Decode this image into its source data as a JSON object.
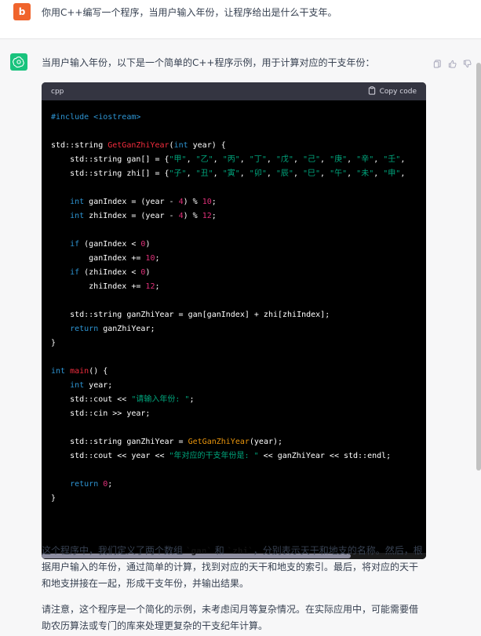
{
  "colors": {
    "user_avatar_bg": "#f0642c",
    "assistant_avatar_bg": "#19c37d"
  },
  "user": {
    "avatar_letter": "b",
    "message": "你用C++编写一个程序，当用户输入年份，让程序给出是什么干支年。"
  },
  "assistant": {
    "intro": "当用户输入年份，以下是一个简单的C++程序示例，用于计算对应的干支年份：",
    "code_language": "cpp",
    "copy_label": "Copy code",
    "paragraph1_before": "这个程序中，我们定义了两个数组 ",
    "paragraph1_code1": "`gan`",
    "paragraph1_mid": " 和 ",
    "paragraph1_code2": "`zhi`",
    "paragraph1_after": "，分别表示天干和地支的名称。然后，根据用户输入的年份，通过简单的计算，找到对应的天干和地支的索引。最后，将对应的天干和地支拼接在一起，形成干支年份，并输出结果。",
    "paragraph2": "请注意，这个程序是一个简化的示例，未考虑闰月等复杂情况。在实际应用中，可能需要借助农历算法或专门的库来处理更复杂的干支纪年计算。"
  },
  "code_lines": [
    "#include <iostream>",
    "",
    "std::string GetGanZhiYear(int year) {",
    "    std::string gan[] = {\"甲\", \"乙\", \"丙\", \"丁\", \"戊\", \"己\", \"庚\", \"辛\", \"壬\",",
    "    std::string zhi[] = {\"子\", \"丑\", \"寅\", \"卯\", \"辰\", \"巳\", \"午\", \"未\", \"申\",",
    "",
    "    int ganIndex = (year - 4) % 10;",
    "    int zhiIndex = (year - 4) % 12;",
    "",
    "    if (ganIndex < 0)",
    "        ganIndex += 10;",
    "    if (zhiIndex < 0)",
    "        zhiIndex += 12;",
    "",
    "    std::string ganZhiYear = gan[ganIndex] + zhi[zhiIndex];",
    "    return ganZhiYear;",
    "}",
    "",
    "int main() {",
    "    int year;",
    "    std::cout << \"请输入年份: \";",
    "    std::cin >> year;",
    "",
    "    std::string ganZhiYear = GetGanZhiYear(year);",
    "    std::cout << year << \"年对应的干支年份是: \" << ganZhiYear << std::endl;",
    "",
    "    return 0;",
    "}"
  ]
}
